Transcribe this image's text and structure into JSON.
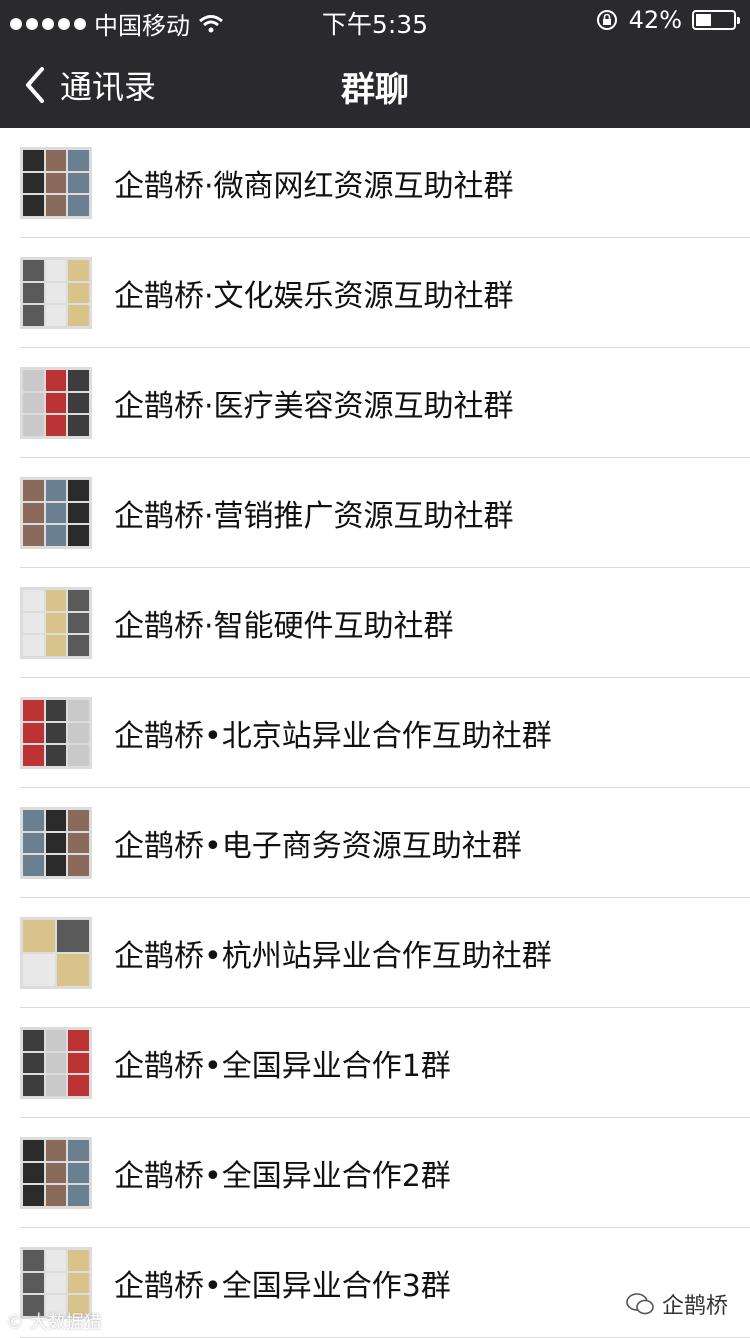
{
  "status": {
    "carrier": "中国移动",
    "time": "下午5:35",
    "battery_text": "42%",
    "battery_level": 0.42,
    "signal_icon": "signal-dots-icon",
    "wifi_icon": "wifi-icon",
    "lock_icon": "rotation-lock-icon"
  },
  "nav": {
    "back_label": "通讯录",
    "title": "群聊"
  },
  "groups": [
    {
      "name": "企鹊桥·微商网红资源互助社群"
    },
    {
      "name": "企鹊桥·文化娱乐资源互助社群"
    },
    {
      "name": "企鹊桥·医疗美容资源互助社群"
    },
    {
      "name": "企鹊桥·营销推广资源互助社群"
    },
    {
      "name": "企鹊桥·智能硬件互助社群"
    },
    {
      "name": "企鹊桥•北京站异业合作互助社群"
    },
    {
      "name": "企鹊桥•电子商务资源互助社群"
    },
    {
      "name": "企鹊桥•杭州站异业合作互助社群"
    },
    {
      "name": "企鹊桥•全国异业合作1群"
    },
    {
      "name": "企鹊桥•全国异业合作2群"
    },
    {
      "name": "企鹊桥•全国异业合作3群"
    }
  ],
  "watermark": {
    "left": "© 大数据猎",
    "right": "企鹊桥"
  },
  "colors": {
    "bar_bg": "#2a2a2e",
    "divider": "#d9d9d9"
  }
}
